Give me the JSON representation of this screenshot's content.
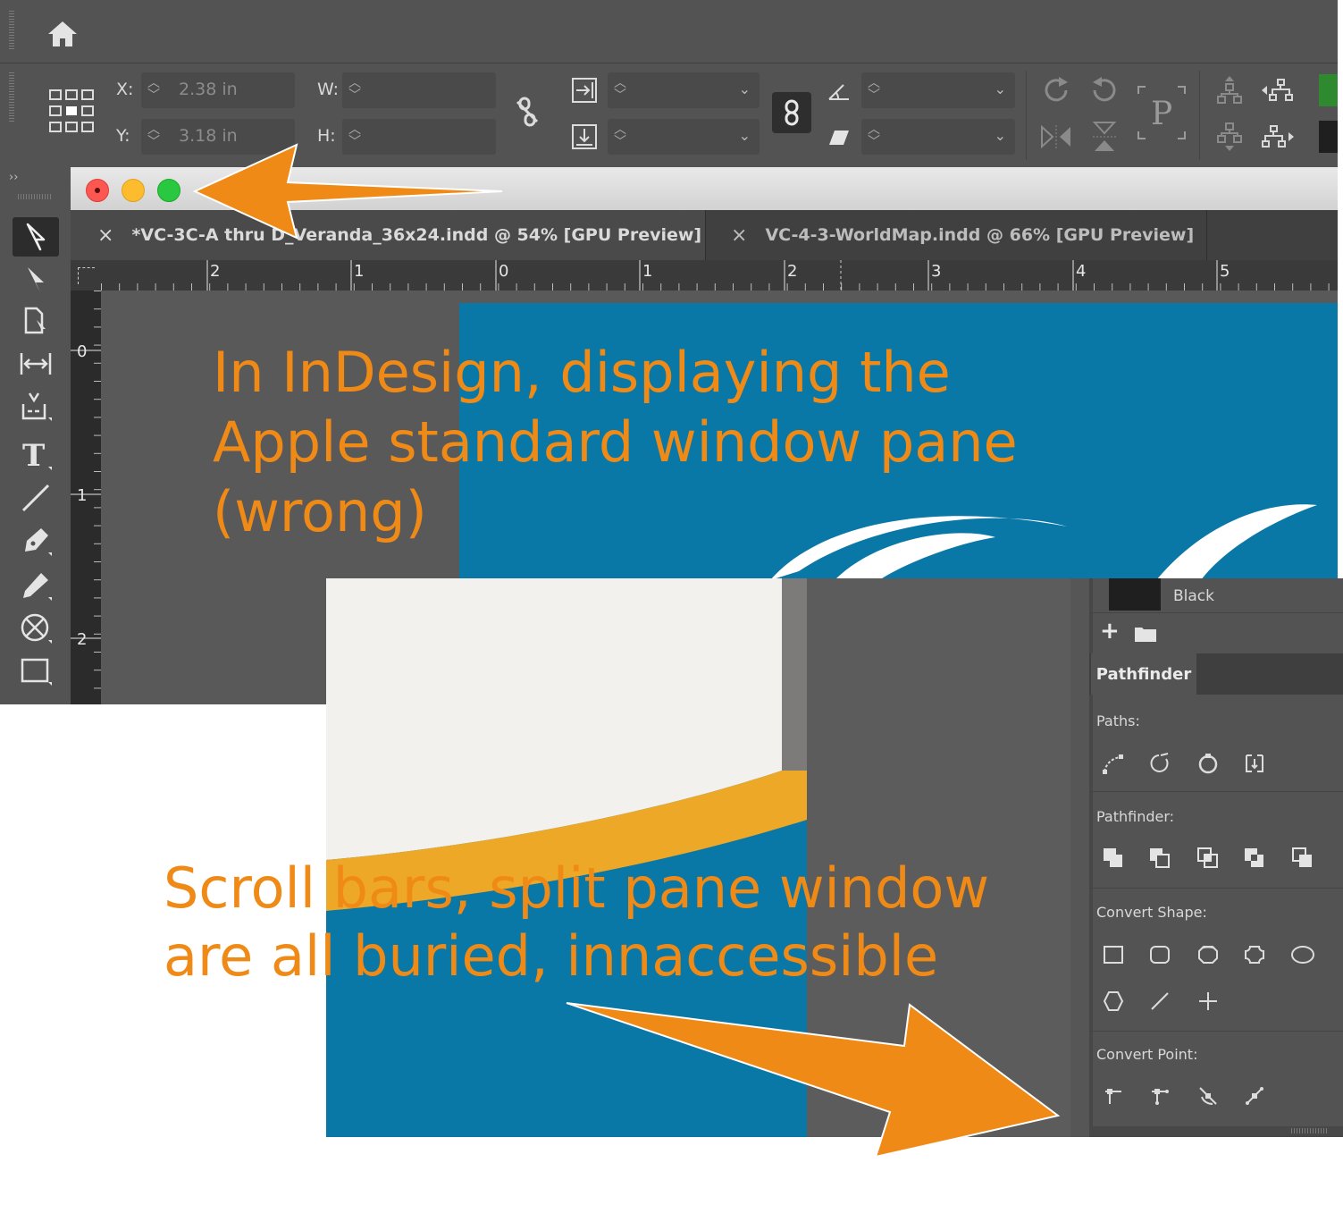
{
  "control": {
    "x_label": "X:",
    "y_label": "Y:",
    "x_value": "2.38 in",
    "y_value": "3.18 in",
    "w_label": "W:",
    "h_label": "H:"
  },
  "tabs": [
    {
      "close": "×",
      "title": "*VC-3C-A thru D_Veranda_36x24.indd @ 54% [GPU Preview]"
    },
    {
      "close": "×",
      "title": "VC-4-3-WorldMap.indd @ 66% [GPU Preview]"
    }
  ],
  "ruler": {
    "h_ticks": [
      "2",
      "1",
      "0",
      "1",
      "2",
      "3",
      "4",
      "5"
    ],
    "v_ticks": [
      "0",
      "1",
      "2"
    ]
  },
  "annotations": {
    "top": [
      "In InDesign, displaying the",
      "Apple standard window pane",
      "(wrong)"
    ],
    "bottom": [
      "Scroll bars, split pane window",
      "are all buried, innaccessible"
    ]
  },
  "panel": {
    "swatch_name": "Black",
    "tab_title": "Pathfinder",
    "paths_label": "Paths:",
    "pathfinder_label": "Pathfinder:",
    "convert_shape_label": "Convert Shape:",
    "convert_point_label": "Convert Point:"
  },
  "colors": {
    "annotation": "#f08a17",
    "doc_blue": "#0a78a6",
    "doc_gold": "#eca826",
    "ui_dark": "#535353"
  }
}
